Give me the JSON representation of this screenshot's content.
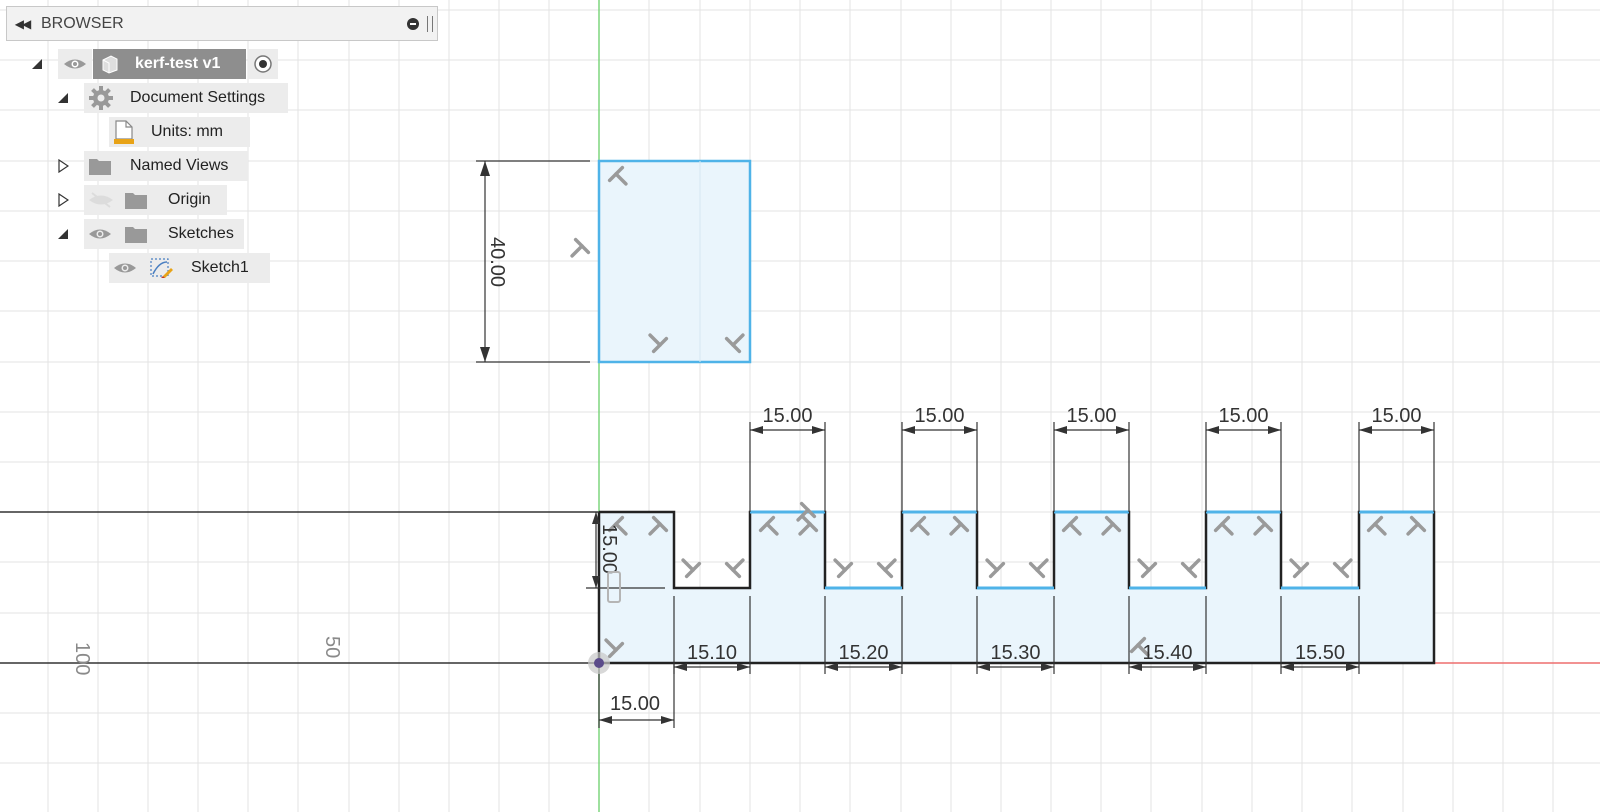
{
  "browser": {
    "title": "BROWSER",
    "tree": [
      {
        "label": "kerf-test v1",
        "icon": "component-icon",
        "visible": true,
        "expanded": true,
        "active": true
      },
      {
        "label": "Document Settings",
        "icon": "gear-icon",
        "expanded": true
      },
      {
        "label": "Units: mm",
        "icon": "document-icon"
      },
      {
        "label": "Named Views",
        "icon": "folder-icon",
        "expanded": false
      },
      {
        "label": "Origin",
        "icon": "folder-icon",
        "visible": false,
        "expanded": false
      },
      {
        "label": "Sketches",
        "icon": "folder-icon",
        "visible": true,
        "expanded": true
      },
      {
        "label": "Sketch1",
        "icon": "sketch-icon",
        "visible": true
      }
    ]
  },
  "sketch": {
    "rect_height_dim": "40.00",
    "tooth_height_dim": "15.00",
    "first_tooth_width_dim": "15.00",
    "tooth_width_dims": [
      "15.00",
      "15.00",
      "15.00",
      "15.00",
      "15.00"
    ],
    "gap_width_dims": [
      "15.10",
      "15.20",
      "15.30",
      "15.40",
      "15.50"
    ]
  },
  "ruler": {
    "labels": [
      "100",
      "50"
    ]
  },
  "colors": {
    "selected_line": "#4fb3e8",
    "profile_fill": "#eaf5fc",
    "y_axis": "#7ed67e",
    "x_axis": "#ee6f6f",
    "grid": "#e3e3e3"
  }
}
